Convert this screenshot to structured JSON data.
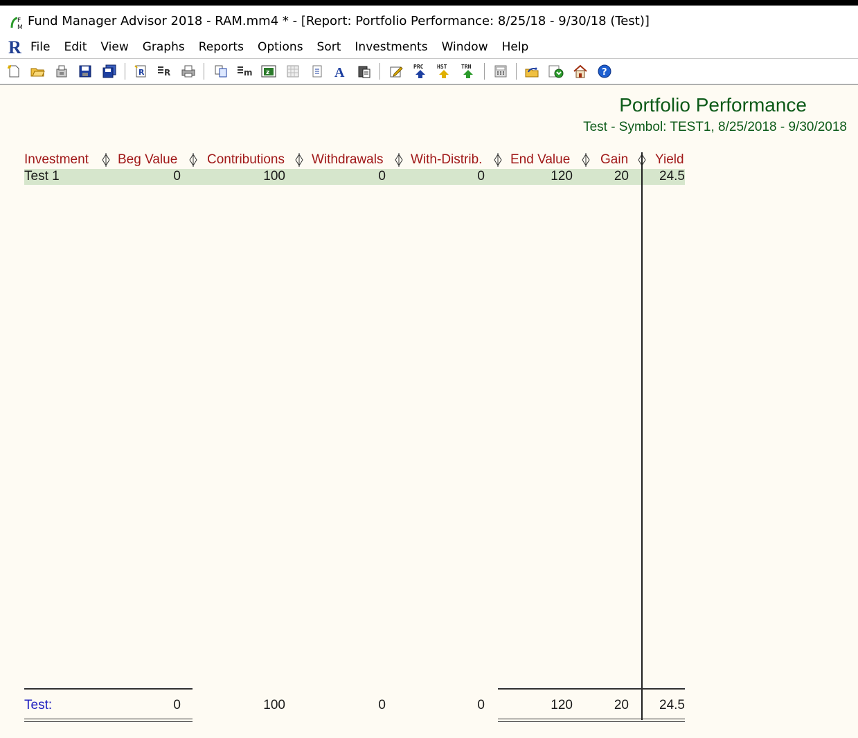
{
  "window": {
    "title": "Fund Manager Advisor 2018 - RAM.mm4 * - [Report: Portfolio Performance: 8/25/18 - 9/30/18 (Test)]",
    "app_icon": "fm-logo-icon"
  },
  "menubar": {
    "logo": "R",
    "items": [
      "File",
      "Edit",
      "View",
      "Graphs",
      "Reports",
      "Options",
      "Sort",
      "Investments",
      "Window",
      "Help"
    ]
  },
  "toolbar": {
    "icons": [
      "new-file-icon",
      "open-folder-icon",
      "open-portfolio-icon",
      "save-icon",
      "save-all-icon",
      "report-icon",
      "report-options-icon",
      "print-icon",
      "copy-icon",
      "export-icon",
      "spreadsheet-icon",
      "columns-icon",
      "page-icon",
      "font-icon",
      "clipboard-icon",
      "edit-icon",
      "download-prc-icon",
      "download-hst-icon",
      "download-trn-icon",
      "calculator-icon",
      "import-icon",
      "update-icon",
      "home-icon",
      "help-icon"
    ],
    "prc": "PRC",
    "hst": "HST",
    "trn": "TRN"
  },
  "report": {
    "title": "Portfolio Performance",
    "subtitle": "Test - Symbol: TEST1, 8/25/2018 - 9/30/2018",
    "columns": [
      "Investment",
      "Beg Value",
      "Contributions",
      "Withdrawals",
      "With-Distrib.",
      "End Value",
      "Gain",
      "Yield"
    ],
    "rows": [
      {
        "investment": "Test 1",
        "beg_value": "0",
        "contributions": "100",
        "withdrawals": "0",
        "with_distrib": "0",
        "end_value": "120",
        "gain": "20",
        "yield": "24.5"
      }
    ],
    "total": {
      "label": "Test:",
      "beg_value": "0",
      "contributions": "100",
      "withdrawals": "0",
      "with_distrib": "0",
      "end_value": "120",
      "gain": "20",
      "yield": "24.5"
    },
    "colors": {
      "background": "#fefbf3",
      "header_text": "#a01818",
      "title_text": "#0c5a18",
      "row_highlight": "#d6e6cc",
      "total_label": "#2020c0"
    }
  }
}
